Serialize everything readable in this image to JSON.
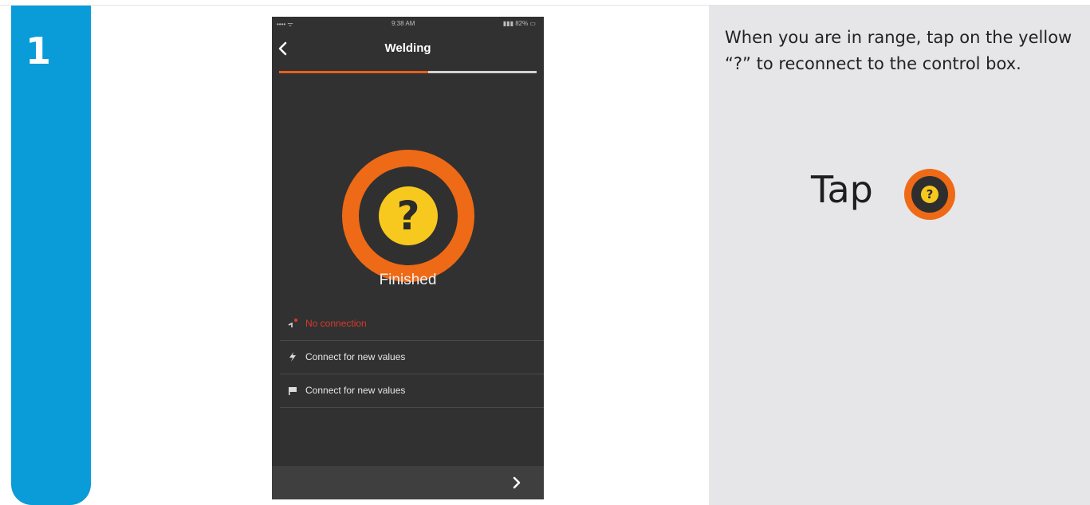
{
  "step": {
    "number": "1"
  },
  "phone": {
    "status_bar": {
      "left": "•••• ᯤ",
      "time": "9:38 AM",
      "right": "▮▮▮ 82% ▭"
    },
    "title": "Welding",
    "progress": 0.58,
    "status_symbol": "?",
    "status_label": "Finished",
    "rows": [
      {
        "icon": "connection-icon",
        "text": "No connection",
        "state": "error"
      },
      {
        "icon": "lightning-icon",
        "text": "Connect for new values"
      },
      {
        "icon": "flag-icon",
        "text": "Connect for new values"
      }
    ],
    "colors": {
      "accent": "#ee6a16",
      "warning": "#f7c91e",
      "background": "#313131"
    }
  },
  "instructions": {
    "text": "When you are in range, tap on the yellow “?” to reconnect to the control box.",
    "tap_label": "Tap",
    "tap_symbol": "?"
  }
}
